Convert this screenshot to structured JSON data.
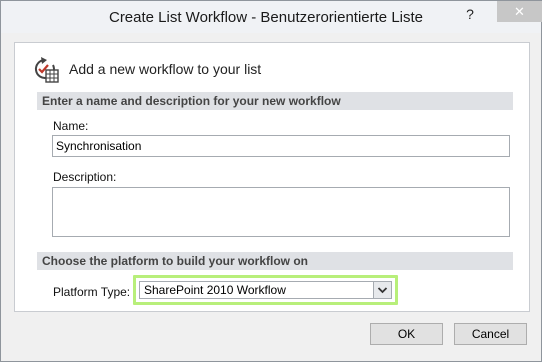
{
  "window": {
    "title": "Create List Workflow - Benutzerorientierte Liste",
    "help_symbol": "?",
    "close_symbol": "✕"
  },
  "header": {
    "icon": "workflow-icon",
    "text": "Add a new workflow to your list"
  },
  "section_name": {
    "title": "Enter a name and description for your new workflow",
    "name_label": "Name:",
    "name_value": "Synchronisation",
    "description_label": "Description:",
    "description_value": ""
  },
  "section_platform": {
    "title": "Choose the platform to build your workflow on",
    "platform_label": "Platform Type:",
    "platform_value": "SharePoint 2010 Workflow"
  },
  "buttons": {
    "ok": "OK",
    "cancel": "Cancel"
  },
  "colors": {
    "highlight": "#b8ef7a",
    "section_bar": "#dfe1e5"
  }
}
